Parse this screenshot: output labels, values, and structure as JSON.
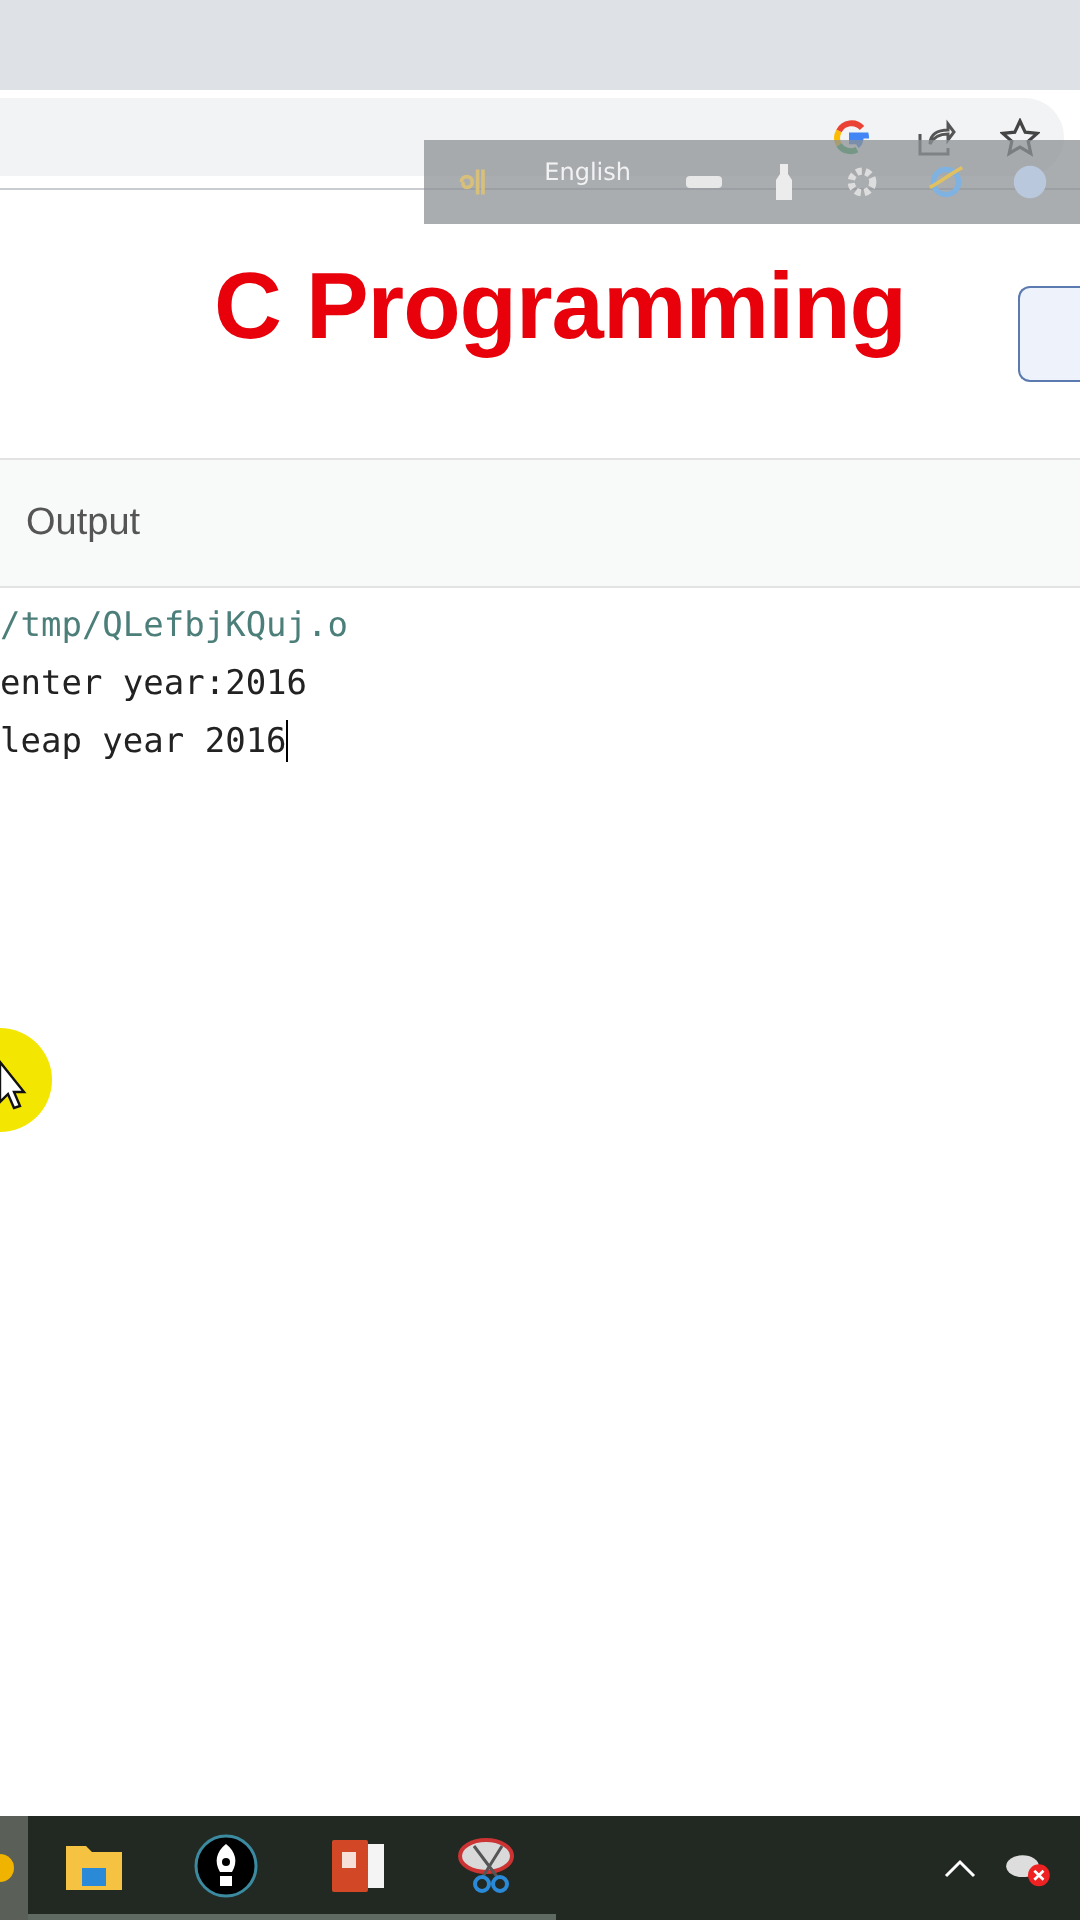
{
  "language_bar": {
    "language": "English"
  },
  "header": {
    "title": "C Programming"
  },
  "output_panel": {
    "label": "Output",
    "lines": [
      {
        "text": "/tmp/QLefbjKQuj.o",
        "kind": "path",
        "caret": false
      },
      {
        "text": "enter year:2016",
        "kind": "plain",
        "caret": false
      },
      {
        "text": "leap year 2016",
        "kind": "plain",
        "caret": true
      }
    ]
  }
}
